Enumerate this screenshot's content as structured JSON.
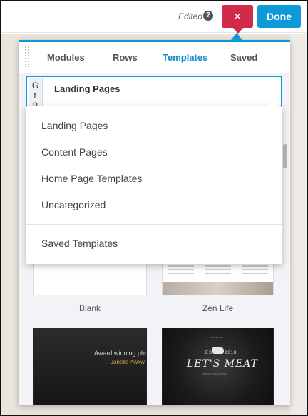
{
  "header": {
    "status_text": "Edited",
    "help_icon": "question-circle-icon",
    "close_label": "×",
    "done_label": "Done"
  },
  "panel": {
    "tabs": [
      {
        "label": "Modules",
        "active": false
      },
      {
        "label": "Rows",
        "active": false
      },
      {
        "label": "Templates",
        "active": true
      },
      {
        "label": "Saved",
        "active": false
      }
    ],
    "group_prefix": "Gro",
    "group_value": "Landing Pages"
  },
  "dropdown": {
    "items": [
      "Landing Pages",
      "Content Pages",
      "Home Page Templates",
      "Uncategorized"
    ],
    "secondary_items": [
      "Saved Templates"
    ]
  },
  "templates": [
    {
      "label": "Blank"
    },
    {
      "label": "Zen Life"
    },
    {
      "label": ""
    },
    {
      "label": ""
    }
  ],
  "thumbs": {
    "dark_line1": "Award winning photograph",
    "dark_line2": "Janelle Awkw",
    "meat_logo": "LET'S MEAT",
    "meat_est": "EST",
    "meat_year": "2018"
  },
  "colors": {
    "accent": "#0e9ad9",
    "close": "#d22b4a",
    "active_tab": "#0e8ed0"
  }
}
